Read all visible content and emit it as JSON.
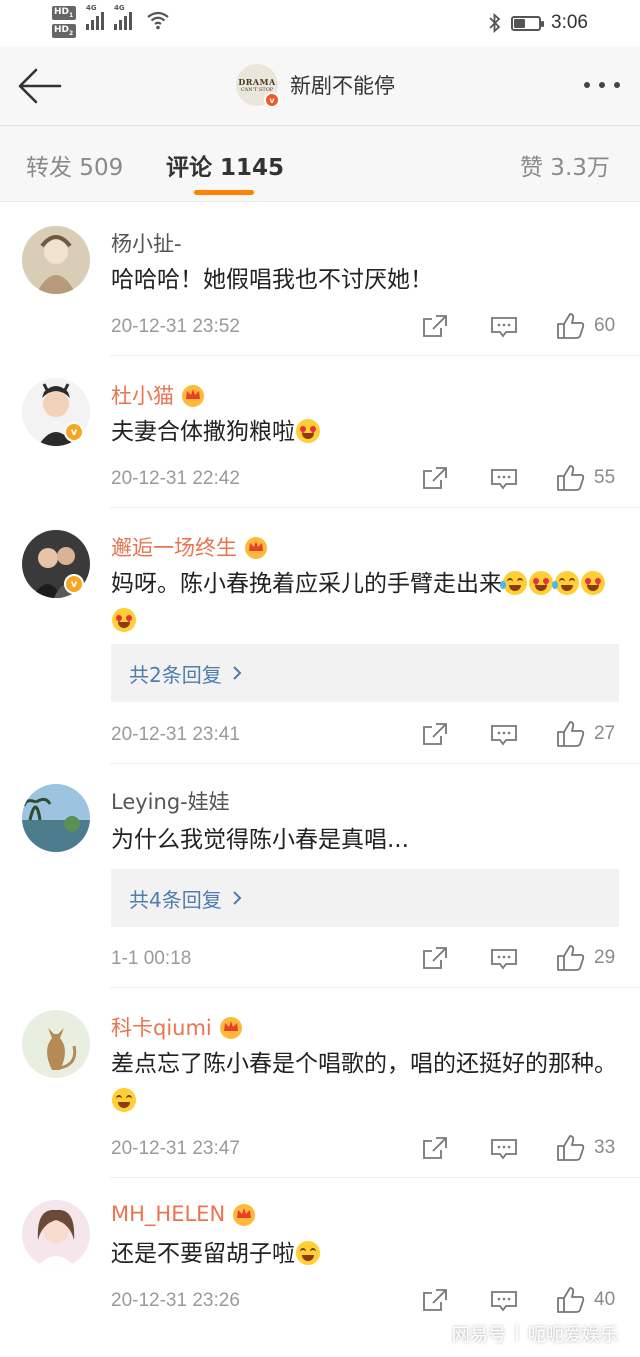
{
  "status_bar": {
    "time": "3:06",
    "network": "4G",
    "hd": "HD"
  },
  "header": {
    "title": "新剧不能停",
    "avatar_text_1": "DRAMA",
    "avatar_text_2": "CAN'T STOP"
  },
  "tabs": [
    {
      "label": "转发 509"
    },
    {
      "label": "评论 1145"
    },
    {
      "label": "赞 3.3万"
    }
  ],
  "colors": {
    "accent": "#ff8200",
    "vip_name": "#eb7350",
    "link": "#507daf"
  },
  "comments": [
    {
      "name": "杨小扯-",
      "text": "哈哈哈！她假唱我也不讨厌她！",
      "time": "20-12-31 23:52",
      "likes": "60",
      "vip": false
    },
    {
      "name": "杜小猫",
      "text": "夫妻合体撒狗粮啦",
      "time": "20-12-31 22:42",
      "likes": "55",
      "vip": true
    },
    {
      "name": "邂逅一场终生",
      "text": "妈呀。陈小春挽着应采儿的手臂走出来",
      "replies": "共2条回复",
      "time": "20-12-31 23:41",
      "likes": "27",
      "vip": true
    },
    {
      "name": "Leying-娃娃",
      "text": "为什么我觉得陈小春是真唱...",
      "replies": "共4条回复",
      "time": "1-1 00:18",
      "likes": "29",
      "vip": false
    },
    {
      "name": "科卡qiumi",
      "text": "差点忘了陈小春是个唱歌的，唱的还挺好的那种。",
      "time": "20-12-31 23:47",
      "likes": "33",
      "vip": true
    },
    {
      "name": "MH_HELEN",
      "text": "还是不要留胡子啦",
      "time": "20-12-31 23:26",
      "likes": "40",
      "vip": true
    }
  ],
  "watermark": {
    "left": "网易号",
    "right": "呃呃爱娱乐"
  }
}
